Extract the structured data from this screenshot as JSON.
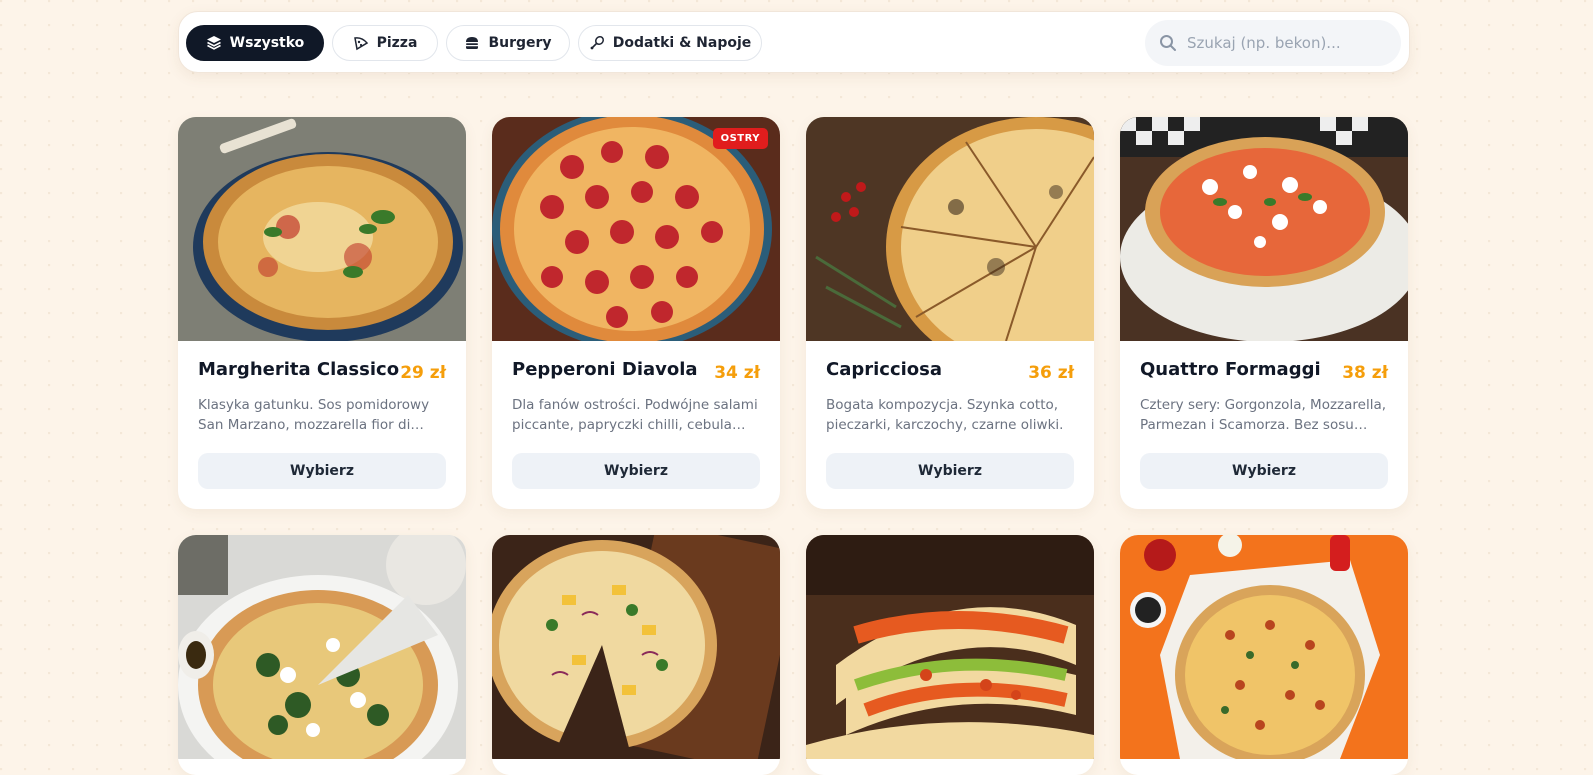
{
  "filters": [
    {
      "label": "Wszystko",
      "icon": "layers-icon",
      "active": true
    },
    {
      "label": "Pizza",
      "icon": "pizza-slice-icon",
      "active": false
    },
    {
      "label": "Burgery",
      "icon": "burger-icon",
      "active": false
    },
    {
      "label": "Dodatki & Napoje",
      "icon": "drumstick-icon",
      "active": false
    }
  ],
  "search": {
    "placeholder": "Szukaj (np. bekon)...",
    "value": ""
  },
  "colors": {
    "accent": "#f59e0b",
    "dark": "#101827",
    "badge": "#e11d1d",
    "background": "#fdf4e9"
  },
  "products": [
    {
      "name": "Margherita Classico",
      "price": "29 zł",
      "description": "Klasyka gatunku. Sos pomidorowy San Marzano, mozzarella fior di latte, świeża bazylia.",
      "button": "Wybierz",
      "badge": ""
    },
    {
      "name": "Pepperoni Diavola",
      "price": "34 zł",
      "description": "Dla fanów ostrości. Podwójne salami piccante, papryczki chilli, cebula czerwona.",
      "button": "Wybierz",
      "badge": "OSTRY"
    },
    {
      "name": "Capricciosa",
      "price": "36 zł",
      "description": "Bogata kompozycja. Szynka cotto, pieczarki, karczochy, czarne oliwki.",
      "button": "Wybierz",
      "badge": ""
    },
    {
      "name": "Quattro Formaggi",
      "price": "38 zł",
      "description": "Cztery sery: Gorgonzola, Mozzarella, Parmezan i Scamorza. Bez sosu pomidorowego.",
      "button": "Wybierz",
      "badge": ""
    },
    {
      "name": "",
      "price": "",
      "description": "",
      "button": "",
      "badge": ""
    },
    {
      "name": "",
      "price": "",
      "description": "",
      "button": "",
      "badge": ""
    },
    {
      "name": "",
      "price": "",
      "description": "",
      "button": "",
      "badge": ""
    },
    {
      "name": "",
      "price": "",
      "description": "",
      "button": "",
      "badge": ""
    }
  ]
}
